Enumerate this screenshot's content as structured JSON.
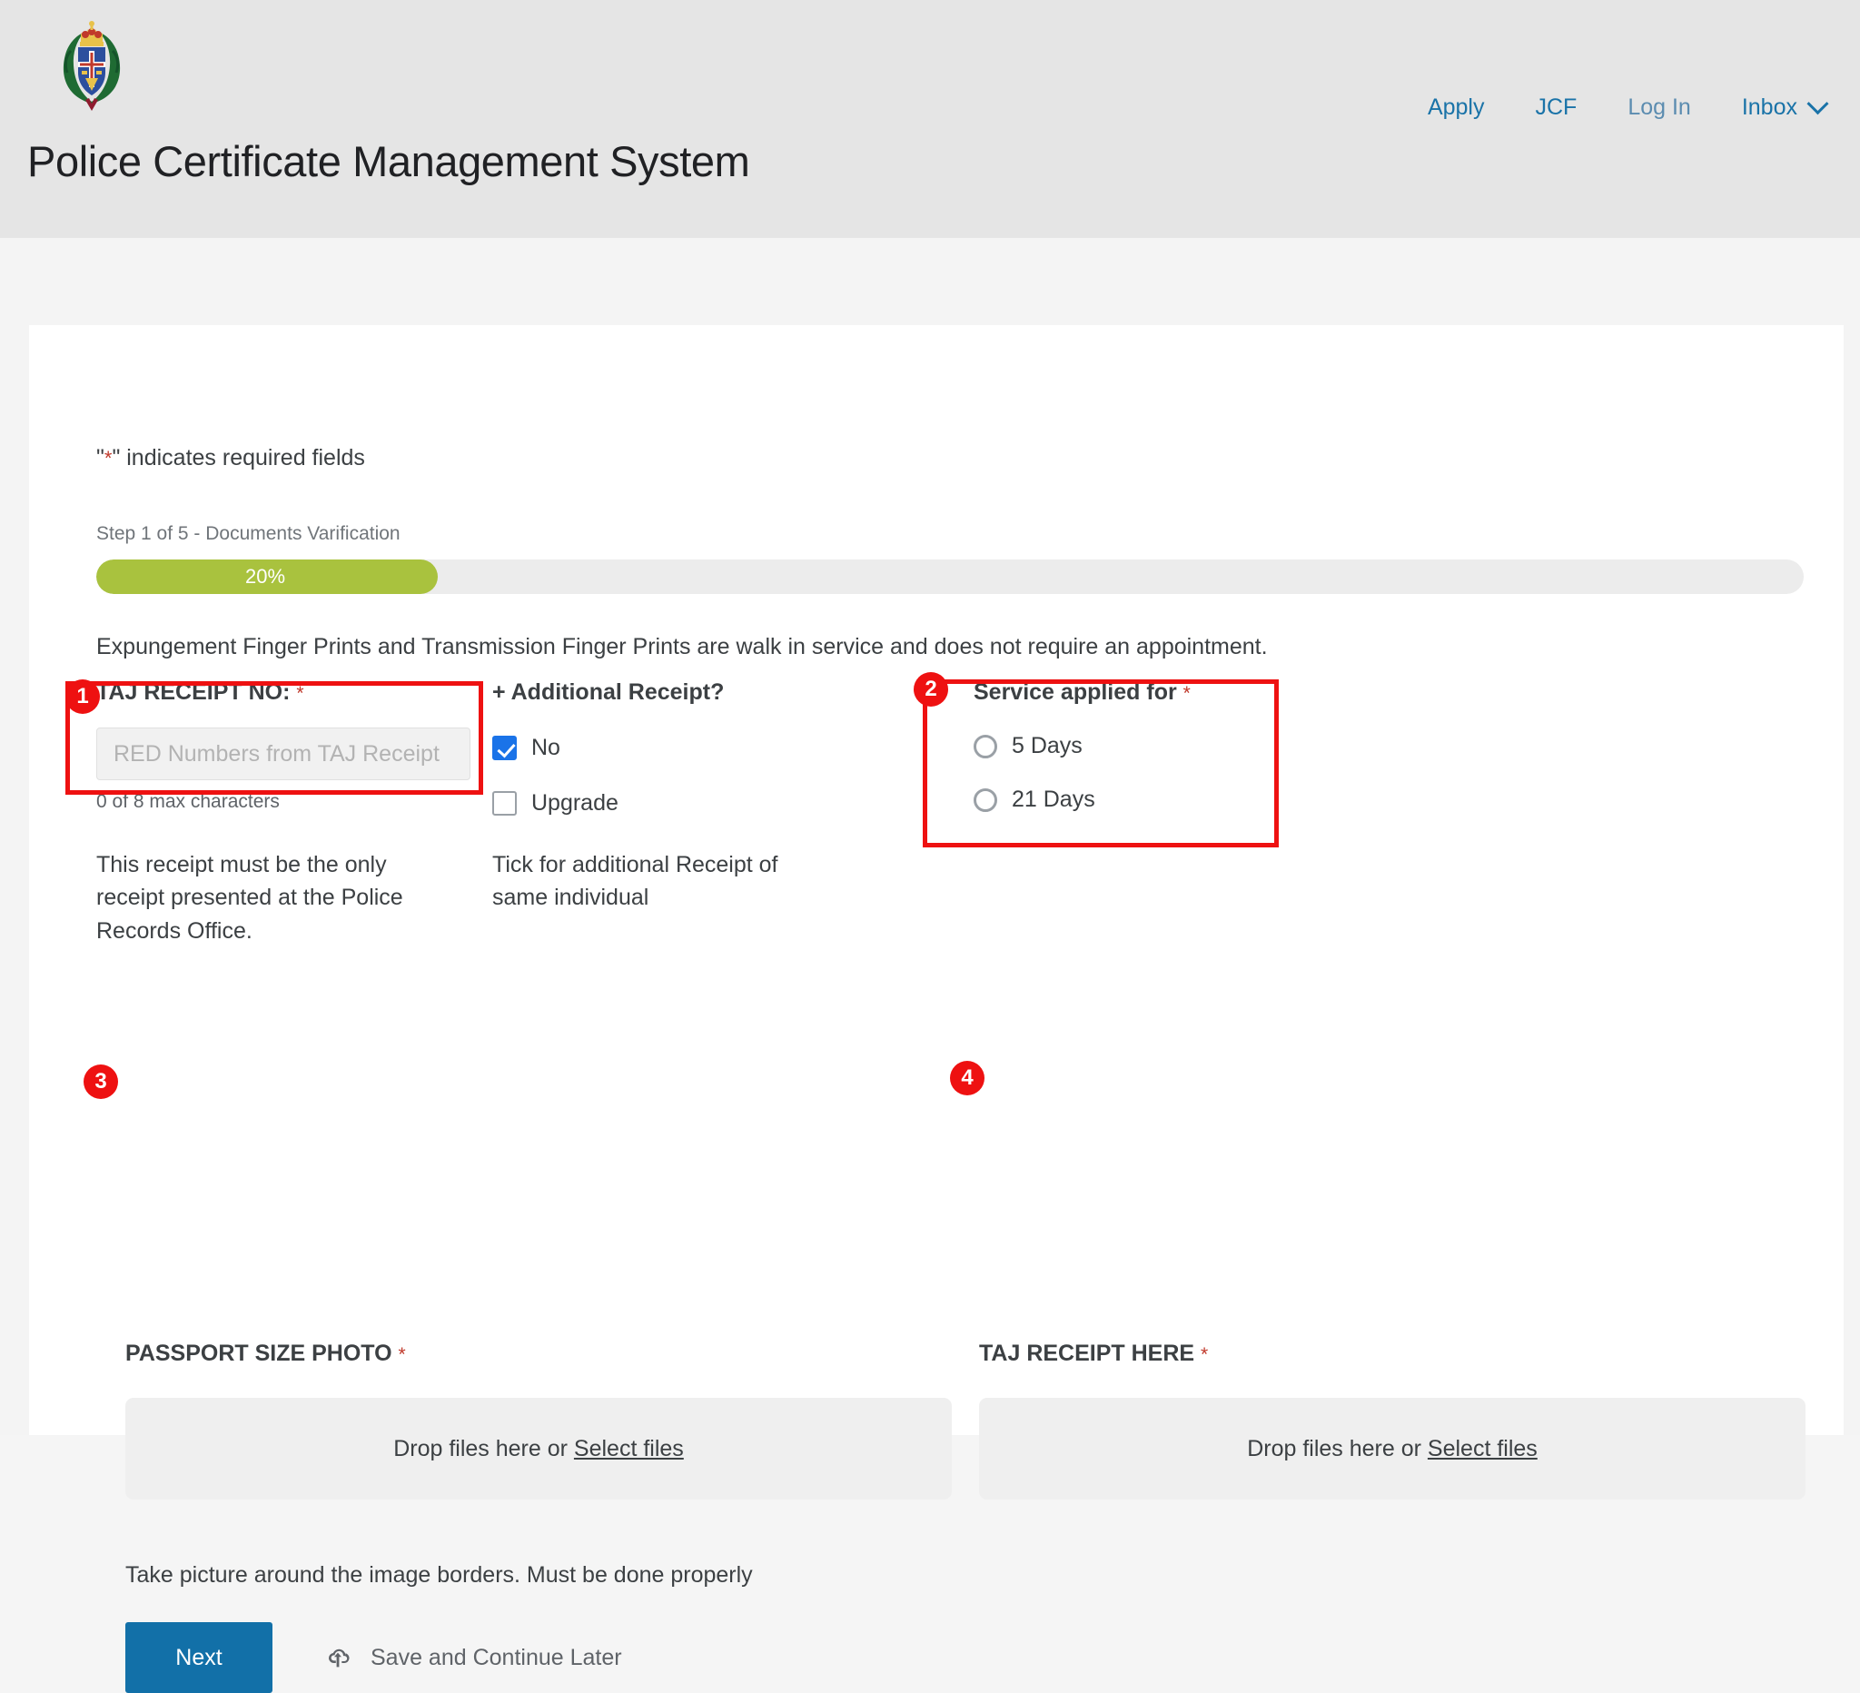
{
  "header": {
    "title": "Police Certificate Management System",
    "crest_icon": "jamaica-constabulary-force-crest-icon",
    "nav": [
      {
        "label": "Apply",
        "name": "nav-link-apply"
      },
      {
        "label": "JCF",
        "name": "nav-link-jcf"
      },
      {
        "label": "Log In",
        "name": "nav-link-login"
      },
      {
        "label": "Inbox",
        "name": "nav-link-inbox"
      }
    ]
  },
  "form": {
    "required_note_pre": "\"",
    "required_note_ast": "*",
    "required_note_post": "\" indicates required fields",
    "step_label": "Step 1 of 5 - Documents Varification",
    "progress_percent_text": "20%",
    "progress_percent_value": 20,
    "notice": "Expungement Finger Prints and Transmission Finger Prints are walk in service and does not require an appointment.",
    "taj_receipt": {
      "label": "TAJ RECEIPT NO:",
      "required_marker": "*",
      "placeholder": "RED Numbers from TAJ Receipt",
      "value": "",
      "char_count": "0 of 8 max characters",
      "help": "This receipt must be the only receipt presented at the Police Records Office."
    },
    "additional_receipt": {
      "label": "+ Additional Receipt?",
      "options": [
        {
          "label": "No",
          "checked": true
        },
        {
          "label": "Upgrade",
          "checked": false
        }
      ],
      "help": "Tick for additional Receipt of same individual"
    },
    "service_applied": {
      "label": "Service applied for",
      "required_marker": "*",
      "options": [
        {
          "label": "5 Days",
          "selected": false
        },
        {
          "label": "21 Days",
          "selected": false
        }
      ]
    },
    "uploads": [
      {
        "label": "PASSPORT SIZE PHOTO",
        "required_marker": "*",
        "drop_text": "Drop files here or ",
        "drop_link": "Select files"
      },
      {
        "label": "TAJ RECEIPT HERE",
        "required_marker": "*",
        "drop_text": "Drop files here or ",
        "drop_link": "Select files"
      }
    ],
    "borders_note": "Take picture around the image borders. Must be done properly",
    "next_label": "Next",
    "save_later_label": "Save and Continue Later",
    "save_later_icon": "cloud-upload-icon"
  },
  "annotations": [
    {
      "number": "1",
      "target": "taj-receipt-field"
    },
    {
      "number": "2",
      "target": "service-applied-group"
    },
    {
      "number": "3",
      "target": "passport-photo-dropzone"
    },
    {
      "number": "4",
      "target": "taj-receipt-dropzone"
    }
  ],
  "colors": {
    "header_bg": "#e5e5e5",
    "nav_link": "#1a73a8",
    "progress_fill": "#a9c23e",
    "checkbox_checked": "#1a73e8",
    "primary_button": "#1270a8",
    "required_asterisk": "#c0392b",
    "annotation": "#ee1111"
  }
}
